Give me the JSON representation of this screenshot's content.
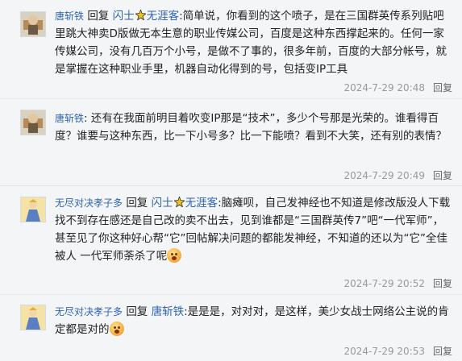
{
  "comments": [
    {
      "user": "唐斩铁",
      "reply_word": "回复",
      "reply_to_1": "闪士",
      "reply_to_2": "无涯客",
      "content": ":简单说，你看到的这个喷子，是在三国群英传系列贴吧里跳大神卖D版做无本生意的职业传媒公司，百度是这种东西撑起来的。任何一家传媒公司，没有几百万个小号，是做不了事的，很多年前，百度的大部分帐号，就是掌握在这种职业手里，机器自动化得到的号，包括变IP工具",
      "time": "2024-7-29 20:48",
      "reply_label": "回复"
    },
    {
      "user": "唐斩铁",
      "content": "还有在我面前明目着吹变IP那是“技术”，多少个号那是光荣的。谁看得百度？谁要与这种东西，比一下小号多？比一下能喷？看到不大笑，还有别的表情？",
      "time": "2024-7-29 20:49",
      "reply_label": "回复"
    },
    {
      "user": "无尽对决孝子多",
      "reply_word": "回复",
      "reply_to_1": "闪士",
      "reply_to_2": "无涯客",
      "content": ":脑瘫呗，自己发神经也不知道是修改版没人下载找不到存在感还是自己改的卖不出去，见到谁都是“三国群英传7”吧“一代军师”，甚至见了你这种好心帮“它”回帖解决问题的都能发神经，不知道的还以为“它”全佳被人 一代军师荼杀了呢",
      "time": "2024-7-29 20:52",
      "reply_label": "回复"
    },
    {
      "user": "无尽对决孝子多",
      "reply_word": "回复",
      "reply_to_1": "唐斩铁",
      "content": ":是是是，对对对，是这样，美少女战士网络公主说的肯定都是对的",
      "time": "2024-7-29 20:53",
      "reply_label": "回复"
    }
  ]
}
